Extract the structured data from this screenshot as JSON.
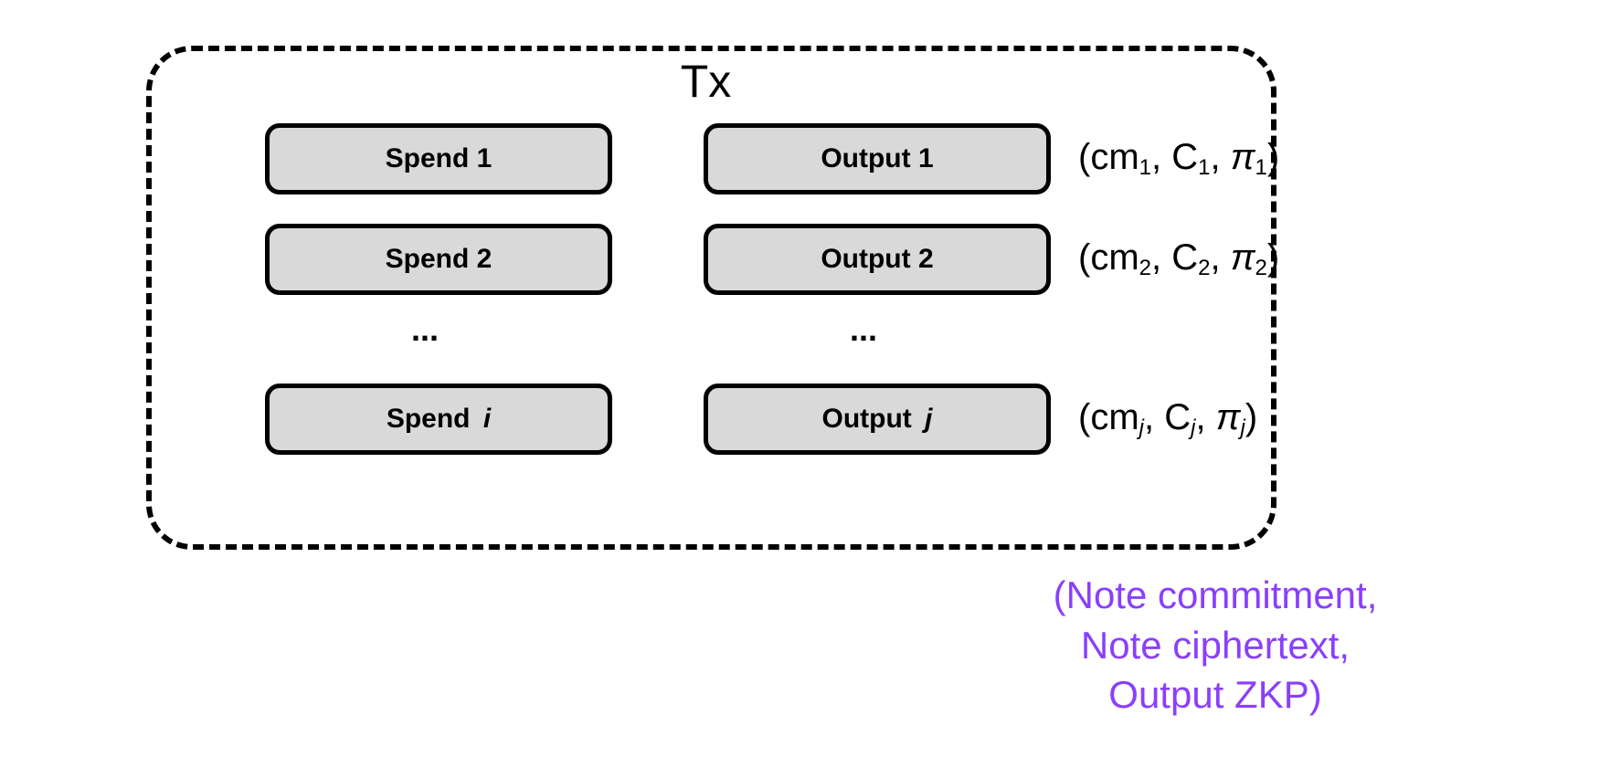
{
  "title": "Tx",
  "spend_prefix": "Spend",
  "output_prefix": "Output",
  "spends": [
    "1",
    "2",
    "i"
  ],
  "outputs": [
    "1",
    "2",
    "j"
  ],
  "ellipsis": "...",
  "ann": {
    "cm": "cm",
    "C": "C",
    "pi": "π",
    "subs": [
      "1",
      "2",
      "j"
    ]
  },
  "legend": {
    "l1": "(Note commitment,",
    "l2": "Note ciphertext,",
    "l3": "Output ZKP)"
  }
}
